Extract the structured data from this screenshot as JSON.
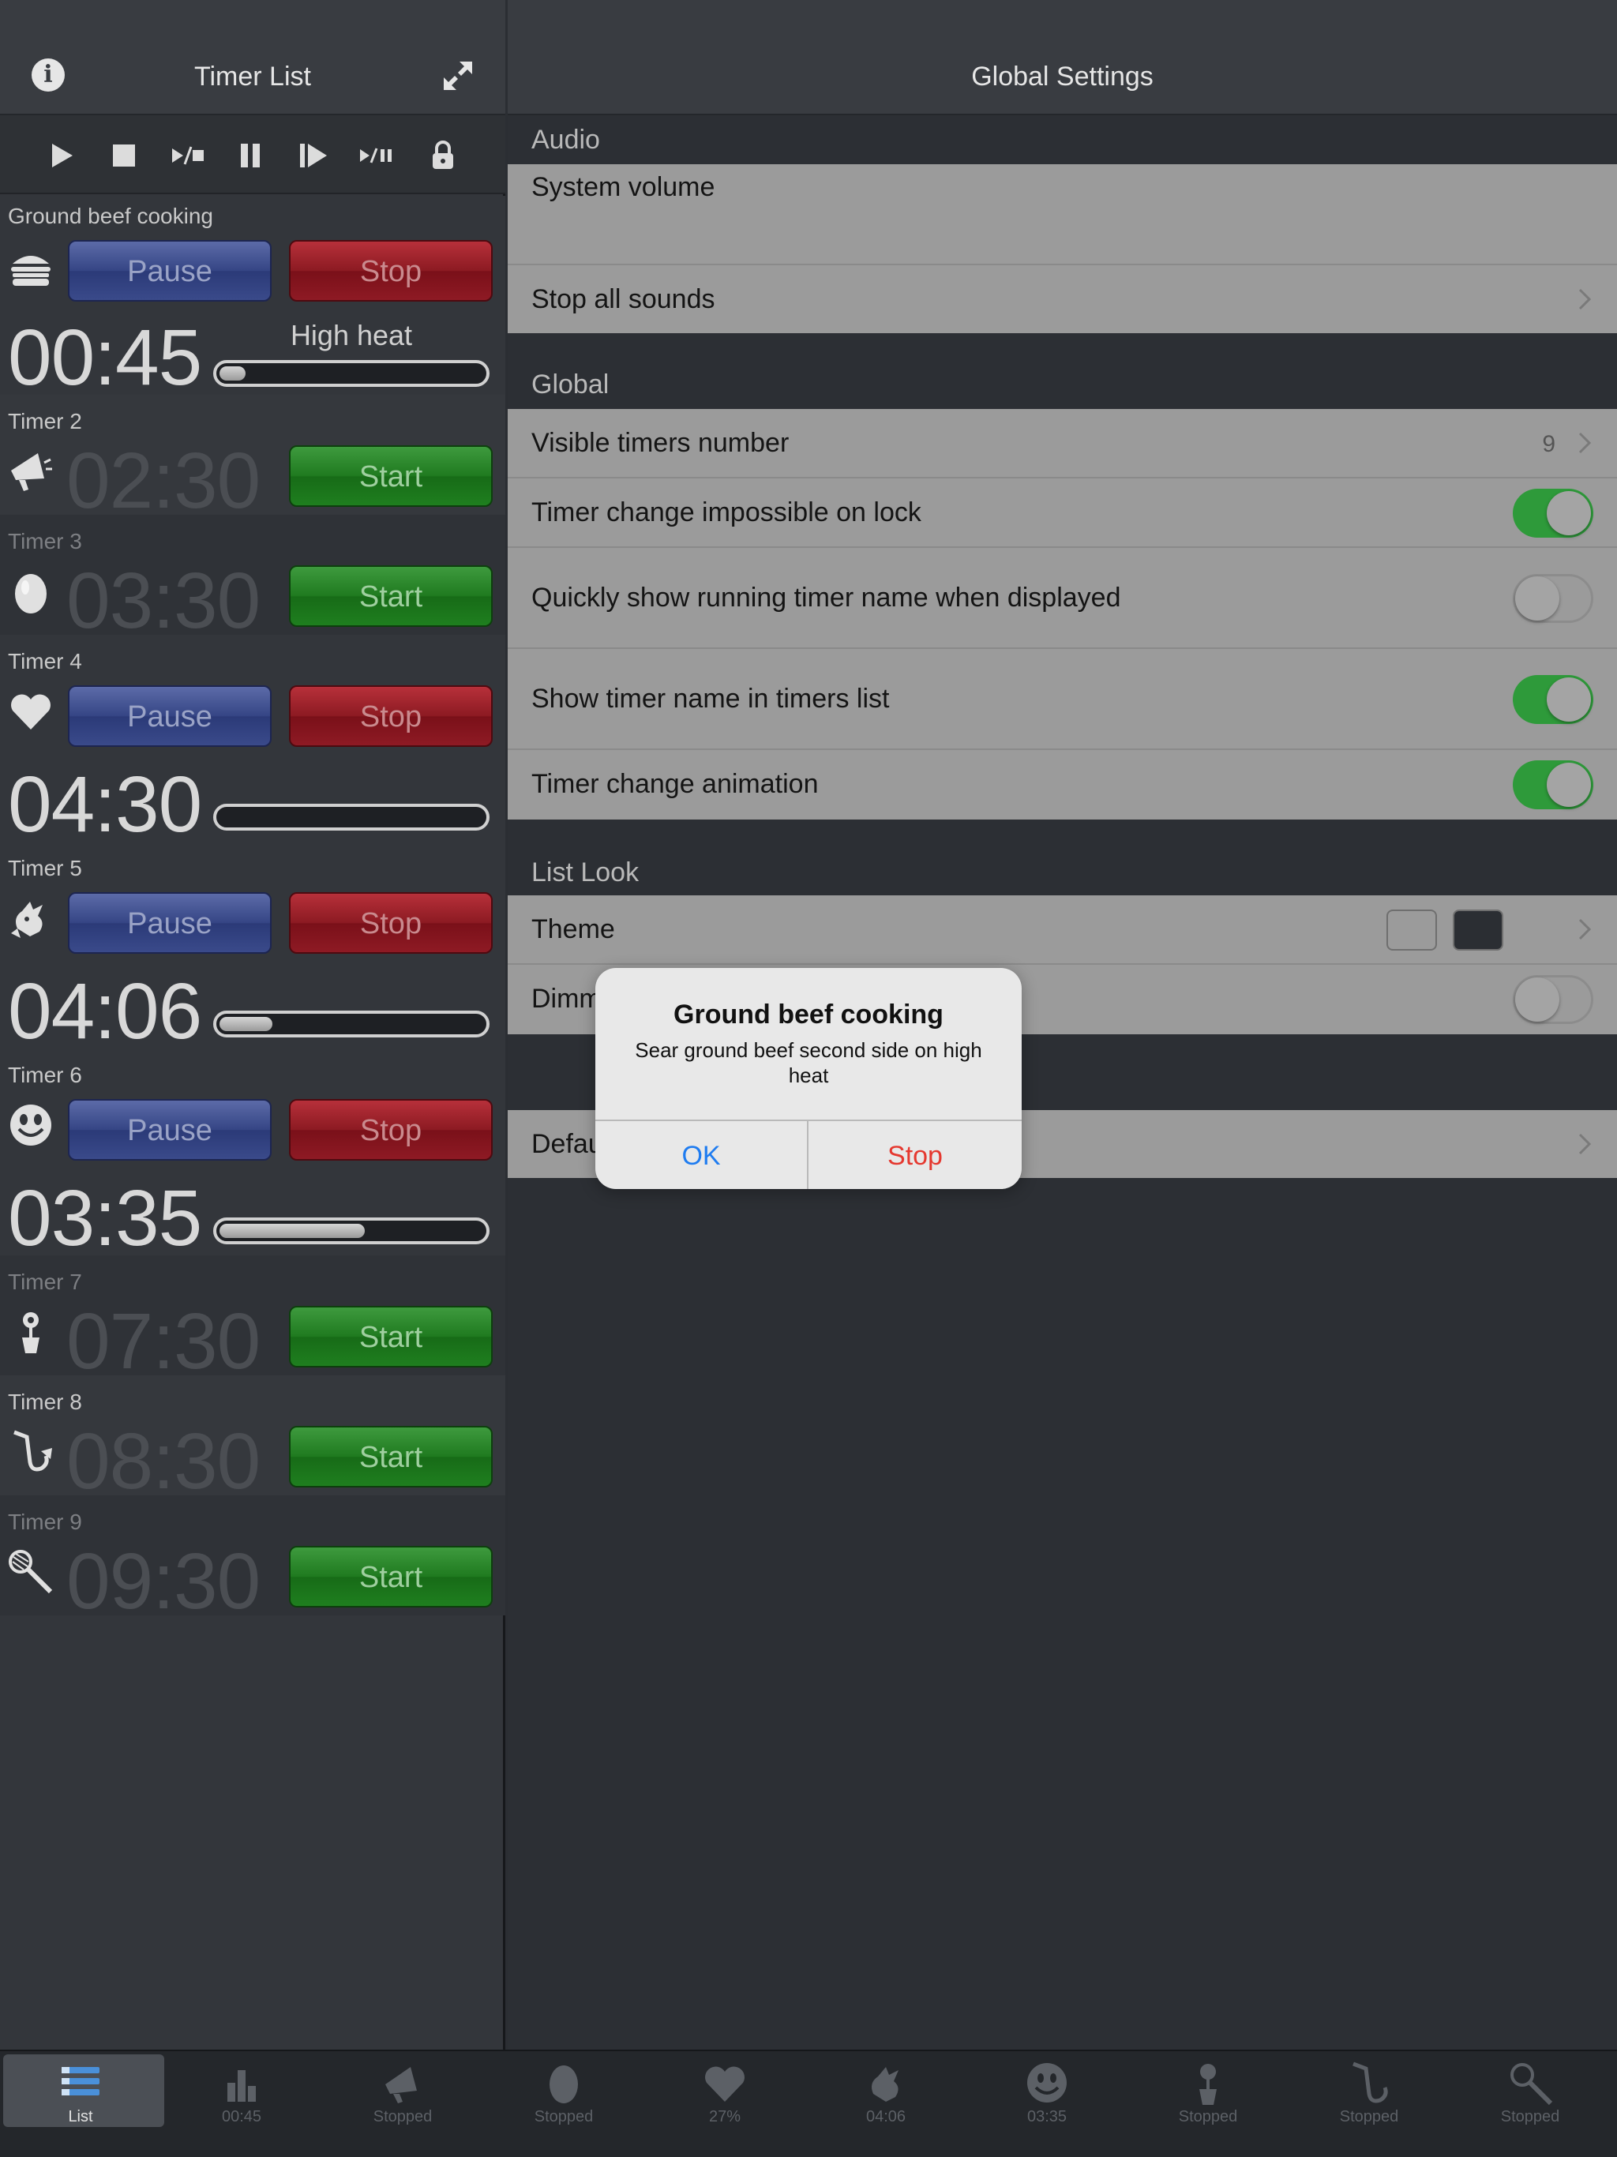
{
  "left_pane": {
    "title": "Timer List",
    "timers": [
      {
        "name": "Ground beef cooking",
        "icon": "burger-icon",
        "state": "running",
        "time": "00:45",
        "subtitle": "High heat",
        "progress": 0.1,
        "pause_label": "Pause",
        "stop_label": "Stop"
      },
      {
        "name": "Timer 2",
        "icon": "megaphone-icon",
        "state": "stopped",
        "time": "02:30",
        "start_label": "Start"
      },
      {
        "name": "Timer 3",
        "icon": "egg-icon",
        "state": "stopped",
        "time": "03:30",
        "start_label": "Start"
      },
      {
        "name": "Timer 4",
        "icon": "heart-icon",
        "state": "running",
        "time": "04:30",
        "progress": 0.0,
        "pause_label": "Pause",
        "stop_label": "Stop"
      },
      {
        "name": "Timer 5",
        "icon": "bull-icon",
        "state": "running",
        "time": "04:06",
        "progress": 0.2,
        "pause_label": "Pause",
        "stop_label": "Stop"
      },
      {
        "name": "Timer 6",
        "icon": "smiley-icon",
        "state": "running",
        "time": "03:35",
        "progress": 0.55,
        "pause_label": "Pause",
        "stop_label": "Stop"
      },
      {
        "name": "Timer 7",
        "icon": "flower-pot-icon",
        "state": "stopped",
        "time": "07:30",
        "start_label": "Start"
      },
      {
        "name": "Timer 8",
        "icon": "saxophone-icon",
        "state": "stopped",
        "time": "08:30",
        "start_label": "Start"
      },
      {
        "name": "Timer 9",
        "icon": "racket-icon",
        "state": "stopped",
        "time": "09:30",
        "start_label": "Start"
      }
    ]
  },
  "right_pane": {
    "title": "Global Settings",
    "sections": {
      "audio": {
        "label": "Audio",
        "system_volume": "System volume",
        "stop_all_sounds": "Stop all sounds"
      },
      "global": {
        "label": "Global",
        "visible_timers_number": "Visible timers number",
        "visible_timers_value": "9",
        "timer_change_lock": "Timer change impossible on lock",
        "timer_change_lock_on": true,
        "quickly_show_name": "Quickly show running timer name when displayed",
        "quickly_show_name_on": false,
        "show_name_in_list": "Show timer name in timers list",
        "show_name_in_list_on": true,
        "timer_change_animation": "Timer change animation",
        "timer_change_animation_on": true
      },
      "list_look": {
        "label": "List Look",
        "theme": "Theme",
        "theme_colors": [
          "#9b9b9b",
          "#2b2e33"
        ],
        "dimm_partial": "Dimm",
        "dimm_on": false
      },
      "defaults": {
        "partial": "Defau"
      }
    }
  },
  "dialog": {
    "title": "Ground beef cooking",
    "message": "Sear ground beef second side on high heat",
    "ok_label": "OK",
    "stop_label": "Stop"
  },
  "tabbar": {
    "tabs": [
      {
        "label": "List",
        "icon": "list-icon",
        "selected": true
      },
      {
        "label": "00:45",
        "icon": "burger-icon"
      },
      {
        "label": "Stopped",
        "icon": "megaphone-icon"
      },
      {
        "label": "Stopped",
        "icon": "egg-icon"
      },
      {
        "label": "27%",
        "icon": "heart-icon"
      },
      {
        "label": "04:06",
        "icon": "bull-icon"
      },
      {
        "label": "03:35",
        "icon": "smiley-icon"
      },
      {
        "label": "Stopped",
        "icon": "flower-pot-icon"
      },
      {
        "label": "Stopped",
        "icon": "saxophone-icon"
      },
      {
        "label": "Stopped",
        "icon": "racket-icon"
      }
    ]
  },
  "colors": {
    "toggle_on": "#2e9a3a",
    "pause_blue": "#354585",
    "stop_red": "#8c1a22",
    "start_green": "#1f7a1f",
    "dialog_ok": "#1f7cf0",
    "dialog_stop": "#e5382f"
  }
}
